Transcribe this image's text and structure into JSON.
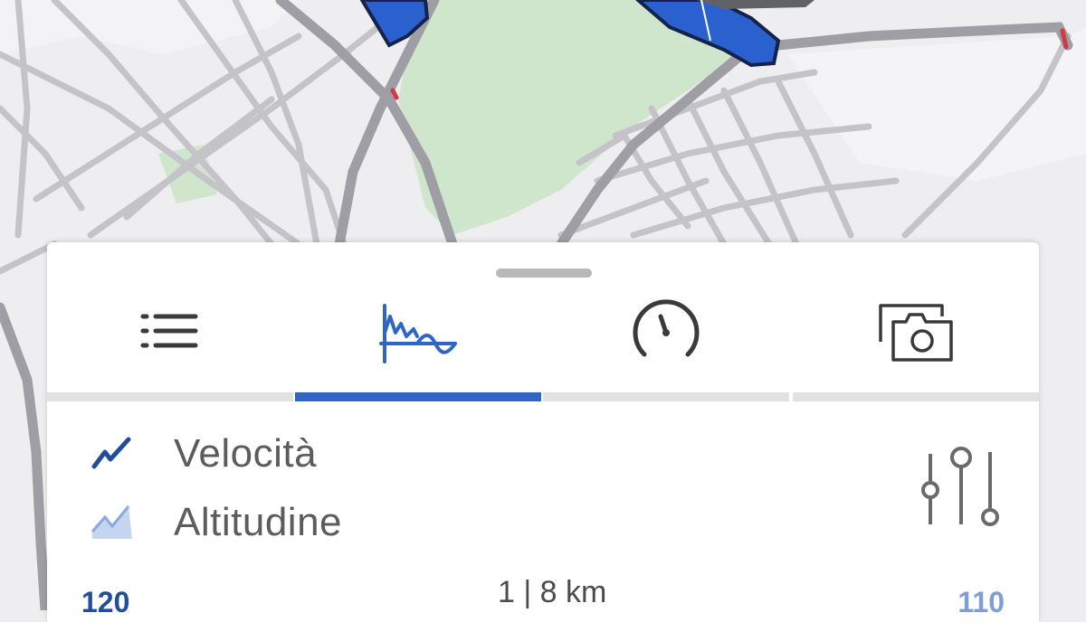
{
  "tabs": [
    {
      "name": "list-icon",
      "active": false
    },
    {
      "name": "chart-icon",
      "active": true
    },
    {
      "name": "speedometer-icon",
      "active": false
    },
    {
      "name": "photo-gallery-icon",
      "active": false
    }
  ],
  "legend": {
    "speed_label": "Velocità",
    "altitude_label": "Altitudine"
  },
  "chart": {
    "left_axis_top": "120",
    "scale_label": "1 | 8 km",
    "right_axis_top": "110"
  },
  "colors": {
    "accent": "#2f66c4",
    "route": "#2a61cf",
    "park": "#cfe6cd"
  }
}
